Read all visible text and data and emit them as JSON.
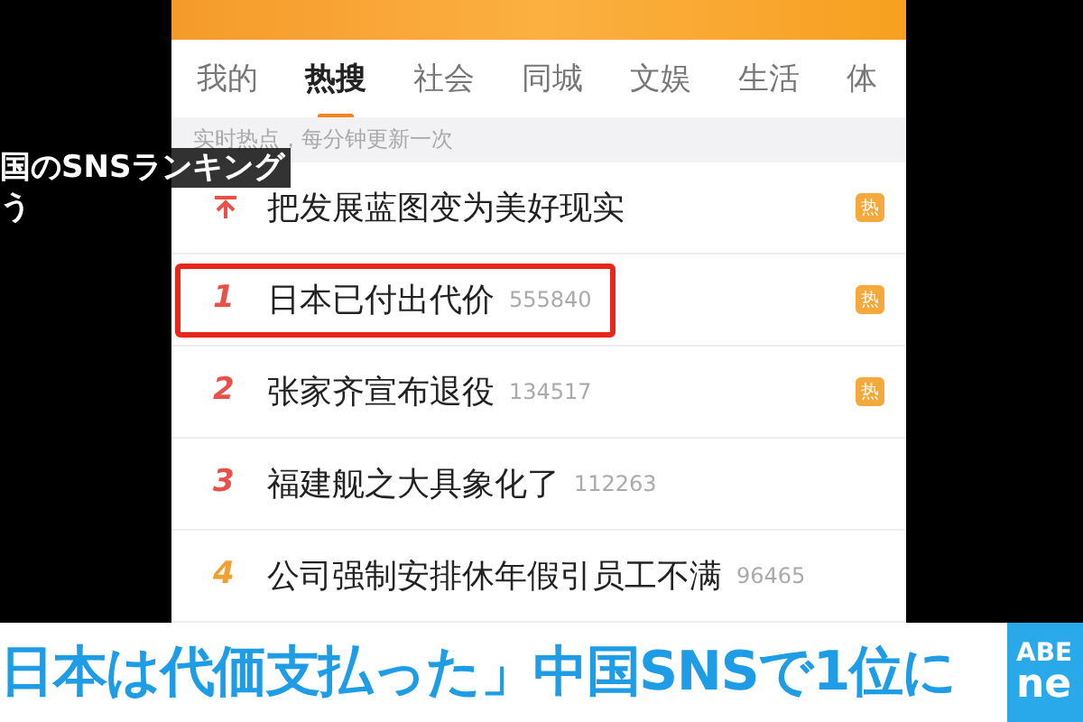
{
  "overlay_caption": [
    "国のSNSランキング",
    "う"
  ],
  "tabs": [
    {
      "label": "我的",
      "selected": false
    },
    {
      "label": "热搜",
      "selected": true
    },
    {
      "label": "社会",
      "selected": false
    },
    {
      "label": "同城",
      "selected": false
    },
    {
      "label": "文娱",
      "selected": false
    },
    {
      "label": "生活",
      "selected": false
    },
    {
      "label": "体",
      "selected": false
    }
  ],
  "notice": "实时热点，每分钟更新一次",
  "rows": [
    {
      "kind": "pinned",
      "title": "把发展蓝图变为美好现实",
      "badge": "热",
      "highlighted": false
    },
    {
      "kind": "ranked",
      "rank": "1",
      "color": "#e8504a",
      "title": "日本已付出代价",
      "count": "555840",
      "badge": "热",
      "highlighted": true
    },
    {
      "kind": "ranked",
      "rank": "2",
      "color": "#e8504a",
      "title": "张家齐宣布退役",
      "count": "134517",
      "badge": "热",
      "highlighted": false
    },
    {
      "kind": "ranked",
      "rank": "3",
      "color": "#e8504a",
      "title": "福建舰之大具象化了",
      "count": "112263",
      "highlighted": false
    },
    {
      "kind": "ranked",
      "rank": "4",
      "color": "#f0a030",
      "title": "公司强制安排休年假引员工不满",
      "count": "96465",
      "highlighted": false
    }
  ],
  "headline": "日本は代価支払った」中国SNSで1位に",
  "logo": [
    "ABE",
    "ne"
  ]
}
